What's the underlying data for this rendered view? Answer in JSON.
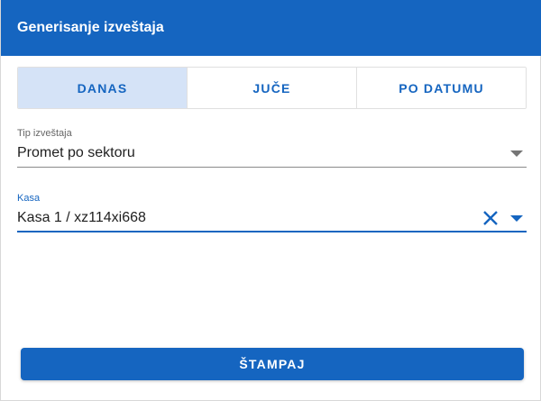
{
  "dialog": {
    "title": "Generisanje izveštaja"
  },
  "tabs": [
    {
      "label": "DANAS",
      "active": true
    },
    {
      "label": "JUČE",
      "active": false
    },
    {
      "label": "PO DATUMU",
      "active": false
    }
  ],
  "fields": {
    "report_type": {
      "label": "Tip izveštaja",
      "value": "Promet po sektoru",
      "icon": "chevron-down-icon"
    },
    "register": {
      "label": "Kasa",
      "value": "Kasa 1 / xz114xi668",
      "clear_icon": "close-icon",
      "icon": "chevron-down-icon"
    }
  },
  "actions": {
    "print_label": "ŠTAMPAJ"
  },
  "colors": {
    "primary": "#1565c0",
    "tab_active_bg": "#d5e3f7"
  }
}
